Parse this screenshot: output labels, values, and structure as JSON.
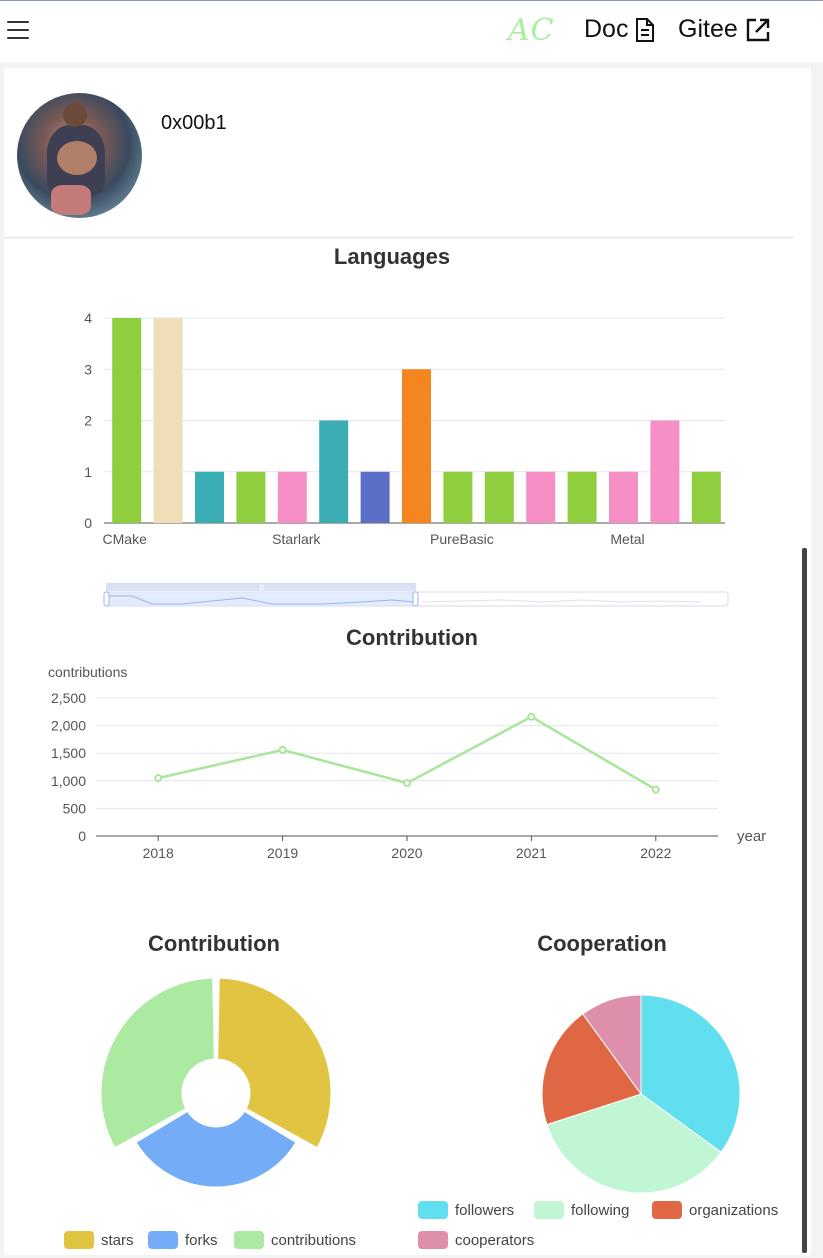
{
  "header": {
    "logo_text": "AC",
    "doc_label": "Doc",
    "gitee_label": "Gitee",
    "logo_color": "#a6f0a0"
  },
  "profile": {
    "username": "0x00b1"
  },
  "chart_data": [
    {
      "type": "bar",
      "title": "Languages",
      "visible_tick_labels": [
        "CMake",
        "Starlark",
        "PureBasic",
        "Metal"
      ],
      "values": [
        4,
        4,
        1,
        1,
        1,
        2,
        1,
        3,
        1,
        1,
        1,
        1,
        1,
        2,
        1
      ],
      "colors": [
        "#8fce3f",
        "#f0dfb6",
        "#3aadb5",
        "#8fce3f",
        "#f58fc6",
        "#3aadb5",
        "#5b6fc7",
        "#f5861f",
        "#8fce3f",
        "#8fce3f",
        "#f58fc6",
        "#8fce3f",
        "#f58fc6",
        "#f58fc6",
        "#8fce3f"
      ],
      "ylim": [
        0,
        4
      ],
      "yticks": [
        0,
        1,
        2,
        3,
        4
      ]
    },
    {
      "type": "line",
      "title": "Contribution",
      "ylabel": "contributions",
      "xlabel": "year",
      "x": [
        "2018",
        "2019",
        "2020",
        "2021",
        "2022"
      ],
      "values": [
        1050,
        1560,
        960,
        2160,
        840
      ],
      "ylim": [
        0,
        2500
      ],
      "yticks": [
        "0",
        "500",
        "1,000",
        "1,500",
        "2,000",
        "2,500"
      ],
      "color": "#a9e59a"
    },
    {
      "type": "pie",
      "title": "Contribution",
      "categories": [
        "stars",
        "forks",
        "contributions"
      ],
      "values": [
        1,
        1,
        1
      ],
      "colors": [
        "#e2c443",
        "#74acf7",
        "#ace9a1"
      ],
      "legend_position": "bottom"
    },
    {
      "type": "pie",
      "title": "Cooperation",
      "categories": [
        "followers",
        "following",
        "organizations",
        "cooperators"
      ],
      "values": [
        35,
        35,
        20,
        10
      ],
      "colors": [
        "#62dfef",
        "#c1f6d5",
        "#e06743",
        "#de8fab"
      ],
      "legend_position": "bottom"
    }
  ]
}
